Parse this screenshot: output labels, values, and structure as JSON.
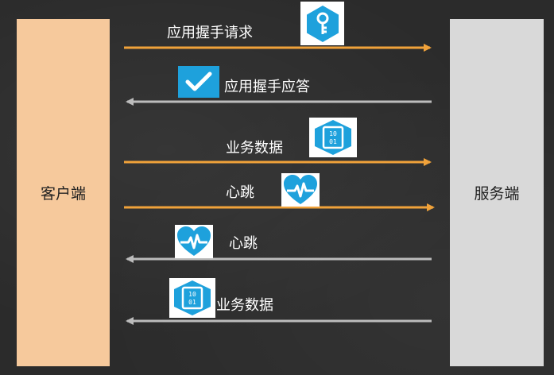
{
  "client": {
    "label": "客户端"
  },
  "server": {
    "label": "服务端"
  },
  "colors": {
    "request_arrow": "#f0a23a",
    "response_arrow": "#bcbcbc",
    "icon_blue": "#1ea1dc",
    "client_box": "#f6c99c",
    "server_box": "#d9d9d9"
  },
  "messages": [
    {
      "label": "应用握手请求",
      "direction": "client-to-server",
      "icon": "key-icon"
    },
    {
      "label": "应用握手应答",
      "direction": "server-to-client",
      "icon": "checkmark-icon"
    },
    {
      "label": "业务数据",
      "direction": "client-to-server",
      "icon": "binary-data-icon"
    },
    {
      "label": "心跳",
      "direction": "client-to-server",
      "icon": "heartbeat-icon"
    },
    {
      "label": "心跳",
      "direction": "server-to-client",
      "icon": "heartbeat-icon"
    },
    {
      "label": "业务数据",
      "direction": "server-to-client",
      "icon": "binary-data-icon"
    }
  ]
}
